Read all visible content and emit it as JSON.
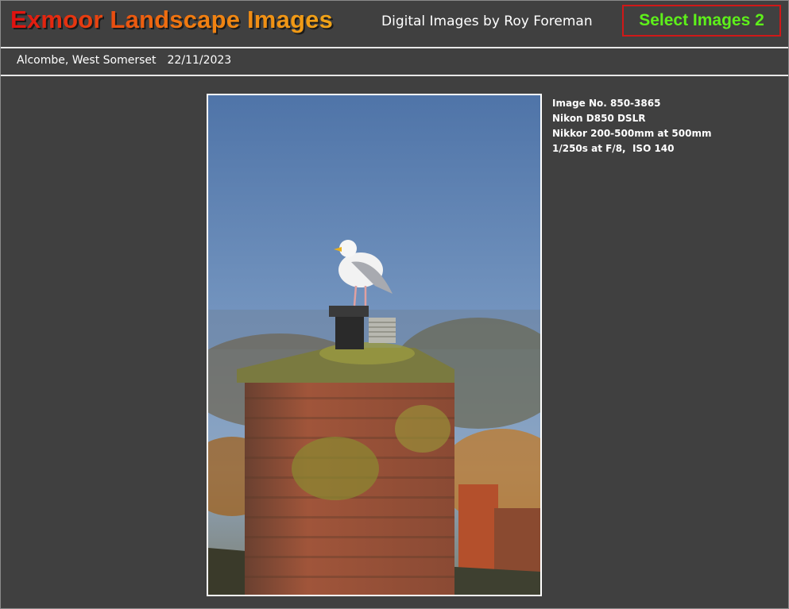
{
  "header": {
    "site_title": "Exmoor Landscape Images",
    "subtitle": "Digital Images by Roy Foreman",
    "select_button": "Select Images 2"
  },
  "location_bar": {
    "place": "Alcombe, West Somerset",
    "date": "22/11/2023"
  },
  "photo": {
    "subject": "herring gull on brick chimney"
  },
  "info": {
    "image_no": "Image No. 850-3865",
    "camera": "Nikon D850 DSLR",
    "lens": "Nikkor 200-500mm at 500mm",
    "exposure": "1/250s at F/8,  ISO 140"
  },
  "colors": {
    "background": "#404040",
    "select_border": "#d01818",
    "select_text": "#5ef01a"
  }
}
